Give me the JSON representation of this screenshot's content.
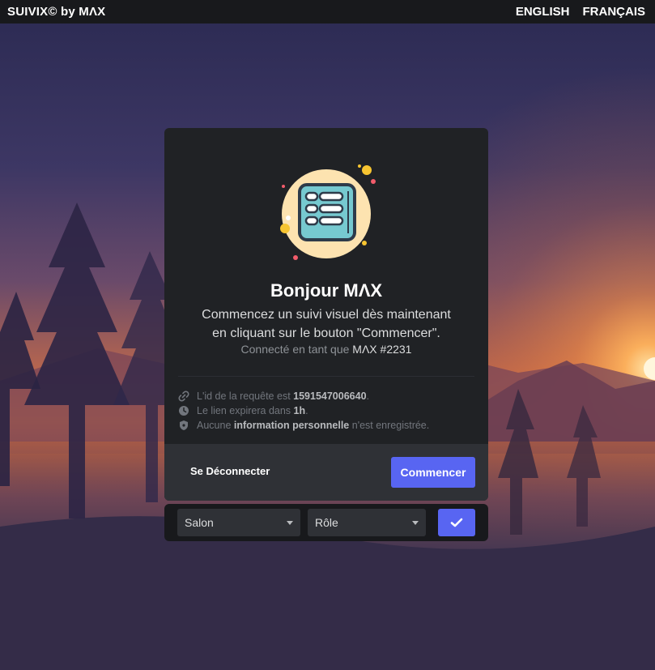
{
  "topbar": {
    "brand": "SUIVIX© by MΛX",
    "lang_en": "ENGLISH",
    "lang_fr": "FRANÇAIS"
  },
  "card": {
    "illustration_icon": "checklist-icon",
    "greeting": "Bonjour MΛX",
    "description_line1": "Commencez un suivi visuel dès maintenant",
    "description_line2": "en cliquant sur le bouton \"Commencer\".",
    "connected_prefix": "Connecté en tant que ",
    "connected_user": "MΛX #2231",
    "info": [
      {
        "icon": "link-icon",
        "prefix": "L'id de la requête est ",
        "bold": "1591547006640",
        "suffix": "."
      },
      {
        "icon": "clock-icon",
        "prefix": "Le lien expirera dans ",
        "bold": "1h",
        "suffix": "."
      },
      {
        "icon": "shield-icon",
        "prefix": "Aucune ",
        "bold": "information personnelle",
        "suffix": " n'est enregistrée."
      }
    ],
    "logout_label": "Se Déconnecter",
    "start_label": "Commencer"
  },
  "selects": {
    "channel": "Salon",
    "role": "Rôle",
    "confirm_icon": "check-icon"
  },
  "colors": {
    "accent": "#5865f2",
    "card_bg": "#202225",
    "footer_bg": "#2f3136",
    "topbar_bg": "#18191c"
  }
}
